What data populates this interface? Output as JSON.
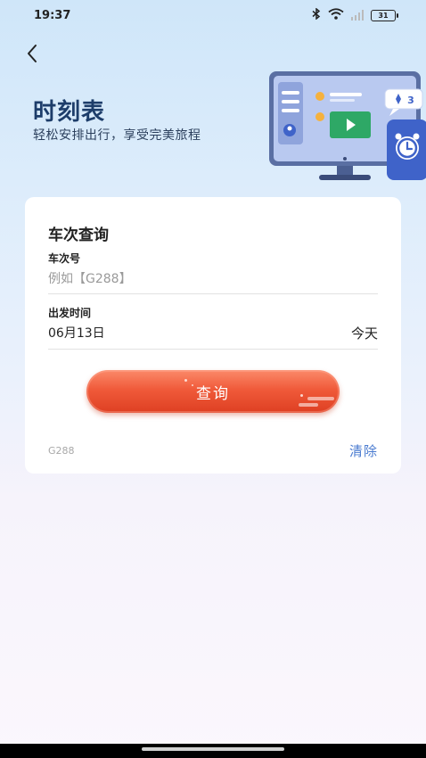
{
  "status_bar": {
    "time": "19:37",
    "battery": "31",
    "icons": [
      "bluetooth-icon",
      "wifi-icon",
      "signal-icon",
      "battery-icon"
    ]
  },
  "header": {
    "title": "时刻表",
    "subtitle": "轻松安排出行，享受完美旅程",
    "illustration_badge": "3"
  },
  "query_card": {
    "title": "车次查询",
    "train_number_label": "车次号",
    "train_number_placeholder": "例如【G288】",
    "train_number_value": "",
    "departure_label": "出发时间",
    "departure_date": "06月13日",
    "today_label": "今天",
    "query_button": "查询",
    "history_item": "G288",
    "clear_button": "清除"
  },
  "colors": {
    "accent_blue": "#4a7bd0",
    "button_red": "#f05a3a",
    "title_navy": "#1d3d6a"
  }
}
